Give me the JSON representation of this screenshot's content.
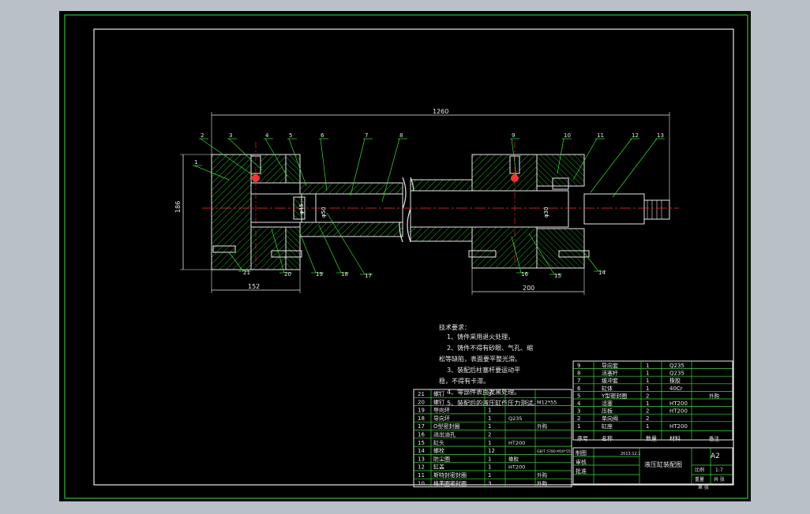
{
  "drawing": {
    "overall_length": "1260",
    "height_dim": "186",
    "left_dim": "152",
    "right_dim": "200",
    "dia_left_1": "φ45",
    "dia_left_2": "φ50",
    "dia_right": "φ30",
    "balloons_top": [
      "1",
      "2",
      "3",
      "4",
      "5",
      "6",
      "7",
      "8",
      "9",
      "10",
      "11",
      "12",
      "13"
    ],
    "balloons_bottom": [
      "21",
      "20",
      "19",
      "18",
      "17",
      "16",
      "15",
      "14"
    ]
  },
  "notes": {
    "heading": "技术要求：",
    "lines": [
      "1、铸件采用退火处理，",
      "2、铸件不得有砂眼、气孔、缩",
      "松等缺陷，表面要平整光滑。",
      "3、装配后柱塞杆要运动平",
      "稳，不得有卡滞。",
      "4、零部件表面发黑处理。",
      "5、装配后的液压缸作压力测试。"
    ]
  },
  "bom_left": {
    "rows": [
      {
        "no": "21",
        "name": "螺钉",
        "qty": "3",
        "mat": "",
        "note": ""
      },
      {
        "no": "20",
        "name": "螺钉",
        "qty": "",
        "mat": "",
        "note": "M12*55"
      },
      {
        "no": "19",
        "name": "导向环",
        "qty": "1",
        "mat": "",
        "note": ""
      },
      {
        "no": "18",
        "name": "导向环",
        "qty": "1",
        "mat": "Q235",
        "note": ""
      },
      {
        "no": "17",
        "name": "O型密封圈",
        "qty": "1",
        "mat": "",
        "note": "外购"
      },
      {
        "no": "16",
        "name": "进出油孔",
        "qty": "2",
        "mat": "",
        "note": ""
      },
      {
        "no": "15",
        "name": "缸头",
        "qty": "1",
        "mat": "HT200",
        "note": ""
      },
      {
        "no": "14",
        "name": "螺栓",
        "qty": "12",
        "mat": "",
        "note": "GB/T 5780 M16*55"
      },
      {
        "no": "13",
        "name": "防尘圈",
        "qty": "1",
        "mat": "橡胶",
        "note": ""
      },
      {
        "no": "12",
        "name": "缸盖",
        "qty": "1",
        "mat": "HT200",
        "note": ""
      },
      {
        "no": "11",
        "name": "斯特封密封圈",
        "qty": "1",
        "mat": "",
        "note": "外购"
      },
      {
        "no": "10",
        "name": "格莱圈密封圈",
        "qty": "3",
        "mat": "",
        "note": "外购"
      }
    ]
  },
  "bom_right": {
    "rows": [
      {
        "no": "9",
        "name": "导向套",
        "qty": "1",
        "mat": "Q235",
        "note": ""
      },
      {
        "no": "8",
        "name": "活塞杆",
        "qty": "1",
        "mat": "Q235",
        "note": ""
      },
      {
        "no": "7",
        "name": "缓冲套",
        "qty": "1",
        "mat": "橡胶",
        "note": ""
      },
      {
        "no": "6",
        "name": "缸体",
        "qty": "1",
        "mat": "40Cr",
        "note": ""
      },
      {
        "no": "5",
        "name": "Y型密封圈",
        "qty": "2",
        "mat": "",
        "note": "外购"
      },
      {
        "no": "4",
        "name": "活塞",
        "qty": "1",
        "mat": "HT200",
        "note": ""
      },
      {
        "no": "3",
        "name": "压板",
        "qty": "2",
        "mat": "HT200",
        "note": ""
      },
      {
        "no": "2",
        "name": "单向阀",
        "qty": "2",
        "mat": "",
        "note": ""
      },
      {
        "no": "1",
        "name": "缸座",
        "qty": "1",
        "mat": "HT200",
        "note": ""
      }
    ],
    "header": {
      "no": "序号",
      "name": "名称",
      "qty": "数量",
      "mat": "材料",
      "note": "备注"
    }
  },
  "title_block": {
    "title": "液压缸装配图",
    "sheet": "A2",
    "scale_label": "比例",
    "scale": "1:7",
    "weight_label": "重量",
    "sheets_label": "共 张",
    "sheet_no": "第 张",
    "roles": [
      "制图",
      "审核",
      "批准"
    ],
    "date": "2013.12.1"
  }
}
